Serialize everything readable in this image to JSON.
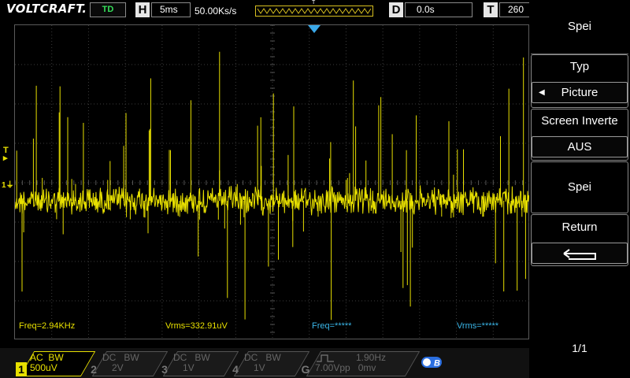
{
  "header": {
    "brand": "VOLTCRAFT.",
    "status": "TD",
    "horizontal_key": "H",
    "timebase": "5ms",
    "sample_rate": "50.00Ks/s",
    "delay_key": "D",
    "delay": "0.0s",
    "trigger_key": "T",
    "trigger_value": "260",
    "memory_marker": "T"
  },
  "measurements": {
    "freq_ch1": "Freq=2.94KHz",
    "vrms_ch1": "Vrms=332.91uV",
    "freq_ch2": "Freq=*****",
    "vrms_ch2": "Vrms=*****"
  },
  "markers": {
    "trigger_level": "T",
    "channel1": "1"
  },
  "menu": {
    "title": "Spei",
    "items": [
      {
        "label": "Typ",
        "value": "Picture"
      },
      {
        "label": "Screen Inverte",
        "value": "AUS"
      },
      {
        "label": "Spei"
      },
      {
        "label": "Return"
      }
    ],
    "page": "1/1"
  },
  "channels": [
    {
      "number": "1",
      "coupling": "AC",
      "bw": "BW",
      "scale": "500uV",
      "active": true
    },
    {
      "number": "2",
      "coupling": "DC",
      "bw": "BW",
      "scale": "2V",
      "active": false
    },
    {
      "number": "3",
      "coupling": "DC",
      "bw": "BW",
      "scale": "1V",
      "active": false
    },
    {
      "number": "4",
      "coupling": "DC",
      "bw": "BW",
      "scale": "1V",
      "active": false
    }
  ],
  "generator": {
    "label": "G",
    "frequency": "1.90Hz",
    "amplitude": "7.00Vpp",
    "offset": "0mv",
    "b_icon": "B"
  },
  "colors": {
    "ch1": "#e8e000",
    "ch2_measure": "#3ab6e8",
    "trigger_marker": "#3aa8e8"
  }
}
